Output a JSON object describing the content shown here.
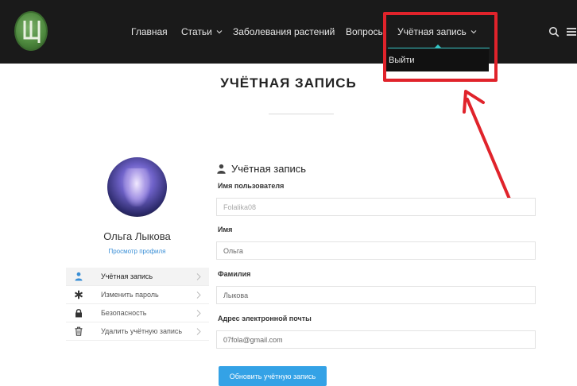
{
  "nav": {
    "items": [
      {
        "label": "Главная"
      },
      {
        "label": "Статьи"
      },
      {
        "label": "Заболевания растений"
      },
      {
        "label": "Вопросы"
      },
      {
        "label": "Учётная запись"
      }
    ],
    "dropdown_item": "Выйти"
  },
  "page": {
    "title": "УЧЁТНАЯ ЗАПИСЬ"
  },
  "profile": {
    "name": "Ольга Лыкова",
    "view_link": "Просмотр профиля"
  },
  "sidebar_menu": [
    {
      "label": "Учётная запись",
      "icon": "user-icon",
      "active": true
    },
    {
      "label": "Изменить пароль",
      "icon": "asterisk-icon",
      "active": false
    },
    {
      "label": "Безопасность",
      "icon": "lock-icon",
      "active": false
    },
    {
      "label": "Удалить учётную запись",
      "icon": "trash-icon",
      "active": false
    }
  ],
  "form": {
    "section_title": "Учётная запись",
    "fields": [
      {
        "label": "Имя пользователя",
        "value": "Folalika08"
      },
      {
        "label": "Имя",
        "value": "Ольга"
      },
      {
        "label": "Фамилия",
        "value": "Лыкова"
      },
      {
        "label": "Адрес электронной почты",
        "value": "07fola@gmail.com"
      }
    ],
    "submit_label": "Обновить учётную запись"
  },
  "colors": {
    "topbar": "#1a1a1a",
    "accent": "#35c4c4",
    "link": "#3a8fd6",
    "button": "#34a2e6",
    "annotation": "#e0232b"
  }
}
